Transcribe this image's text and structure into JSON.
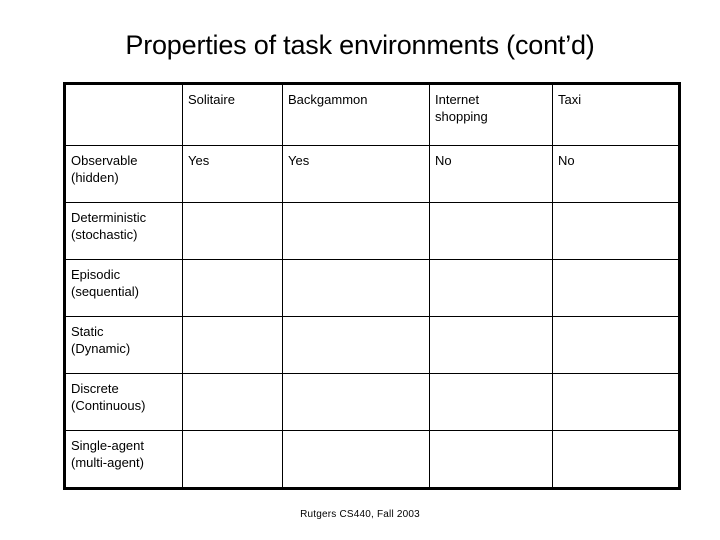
{
  "slide": {
    "title": "Properties of task environments (cont’d)",
    "footer": "Rutgers CS440, Fall 2003"
  },
  "table": {
    "columns": [
      {
        "id": "property",
        "label": ""
      },
      {
        "id": "solitaire",
        "label": "Solitaire"
      },
      {
        "id": "backgammon",
        "label": "Backgammon"
      },
      {
        "id": "internet_shopping",
        "label": "Internet shopping",
        "line1": "Internet",
        "line2": "shopping"
      },
      {
        "id": "taxi",
        "label": "Taxi"
      }
    ],
    "rows": [
      {
        "id": "observable",
        "label_line1": "Observable",
        "label_line2": "(hidden)",
        "values": [
          "Yes",
          "Yes",
          "No",
          "No"
        ]
      },
      {
        "id": "deterministic",
        "label_line1": "Deterministic",
        "label_line2": "(stochastic)",
        "values": [
          "",
          "",
          "",
          ""
        ]
      },
      {
        "id": "episodic",
        "label_line1": "Episodic",
        "label_line2": "(sequential)",
        "values": [
          "",
          "",
          "",
          ""
        ]
      },
      {
        "id": "static",
        "label_line1": "Static",
        "label_line2": "(Dynamic)",
        "values": [
          "",
          "",
          "",
          ""
        ]
      },
      {
        "id": "discrete",
        "label_line1": "Discrete",
        "label_line2": "(Continuous)",
        "values": [
          "",
          "",
          "",
          ""
        ]
      },
      {
        "id": "single_agent",
        "label_line1": "Single-agent",
        "label_line2": "(multi-agent)",
        "values": [
          "",
          "",
          "",
          ""
        ]
      }
    ]
  },
  "colors": {
    "text": "#000000",
    "background": "#ffffff",
    "table_border": "#000000"
  }
}
